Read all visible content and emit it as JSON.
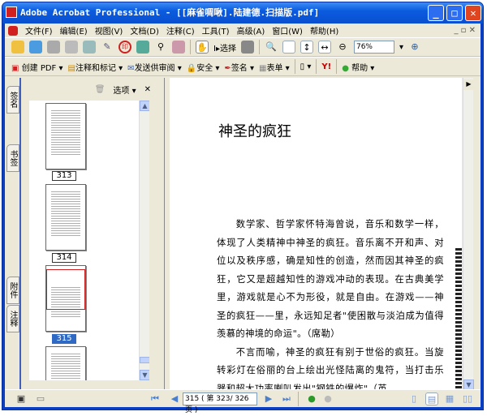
{
  "window": {
    "title": "Adobe Acrobat Professional - [[麻雀啁啾].陆建德.扫描版.pdf]"
  },
  "menu": [
    "文件(F)",
    "编辑(E)",
    "视图(V)",
    "文档(D)",
    "注释(C)",
    "工具(T)",
    "高级(A)",
    "窗口(W)",
    "帮助(H)"
  ],
  "toolbar1": {
    "select_label": "选择",
    "zoom_value": "76%"
  },
  "toolbar2": {
    "create_pdf": "创建 PDF",
    "comment": "注释和标记",
    "review": "发送供审阅",
    "security": "安全",
    "sign": "签名",
    "forms": "表单",
    "help": "帮助"
  },
  "side_tabs": [
    "签名",
    "书签",
    "附件",
    "注释"
  ],
  "nav": {
    "options_label": "选项",
    "thumbnails": [
      "313",
      "314",
      "315"
    ],
    "selected": "315"
  },
  "document": {
    "title": "神圣的疯狂",
    "paragraphs": [
      "数学家、哲学家怀特海曾说，音乐和数学一样，体现了人类精神中神圣的疯狂。音乐离不开和声、对位以及秩序感，确是知性的创造，然而因其神圣的疯狂，它又是超越知性的游戏冲动的表现。在古典美学里，游戏就是心不为形役，就是自由。在游戏——神圣的疯狂——里，永远知足者\"使困散与淡泊成为值得羡慕的神境的命运\"。（席勒）",
      "不言而喻，神圣的疯狂有别于世俗的疯狂。当旋转彩灯在俗丽的台上绘出光怪陆离的鬼符，当打击乐器和超大功率喇叭发出\"钢铁的爆炸\"（英"
    ]
  },
  "status": {
    "page_field": "315 ( 第 323/ 326 页 )"
  }
}
